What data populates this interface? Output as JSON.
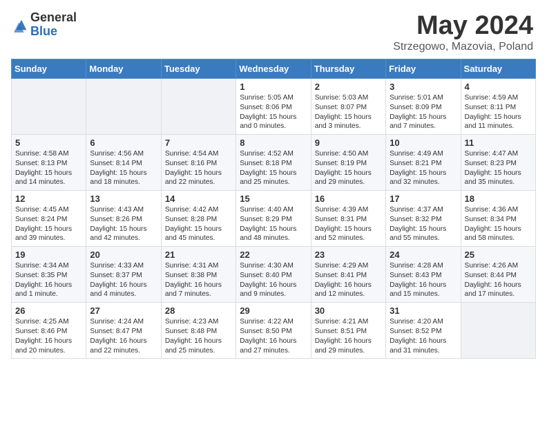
{
  "header": {
    "logo_general": "General",
    "logo_blue": "Blue",
    "month_title": "May 2024",
    "location": "Strzegowo, Mazovia, Poland"
  },
  "weekdays": [
    "Sunday",
    "Monday",
    "Tuesday",
    "Wednesday",
    "Thursday",
    "Friday",
    "Saturday"
  ],
  "weeks": [
    [
      {
        "day": "",
        "sunrise": "",
        "sunset": "",
        "daylight": ""
      },
      {
        "day": "",
        "sunrise": "",
        "sunset": "",
        "daylight": ""
      },
      {
        "day": "",
        "sunrise": "",
        "sunset": "",
        "daylight": ""
      },
      {
        "day": "1",
        "sunrise": "Sunrise: 5:05 AM",
        "sunset": "Sunset: 8:06 PM",
        "daylight": "Daylight: 15 hours and 0 minutes."
      },
      {
        "day": "2",
        "sunrise": "Sunrise: 5:03 AM",
        "sunset": "Sunset: 8:07 PM",
        "daylight": "Daylight: 15 hours and 3 minutes."
      },
      {
        "day": "3",
        "sunrise": "Sunrise: 5:01 AM",
        "sunset": "Sunset: 8:09 PM",
        "daylight": "Daylight: 15 hours and 7 minutes."
      },
      {
        "day": "4",
        "sunrise": "Sunrise: 4:59 AM",
        "sunset": "Sunset: 8:11 PM",
        "daylight": "Daylight: 15 hours and 11 minutes."
      }
    ],
    [
      {
        "day": "5",
        "sunrise": "Sunrise: 4:58 AM",
        "sunset": "Sunset: 8:13 PM",
        "daylight": "Daylight: 15 hours and 14 minutes."
      },
      {
        "day": "6",
        "sunrise": "Sunrise: 4:56 AM",
        "sunset": "Sunset: 8:14 PM",
        "daylight": "Daylight: 15 hours and 18 minutes."
      },
      {
        "day": "7",
        "sunrise": "Sunrise: 4:54 AM",
        "sunset": "Sunset: 8:16 PM",
        "daylight": "Daylight: 15 hours and 22 minutes."
      },
      {
        "day": "8",
        "sunrise": "Sunrise: 4:52 AM",
        "sunset": "Sunset: 8:18 PM",
        "daylight": "Daylight: 15 hours and 25 minutes."
      },
      {
        "day": "9",
        "sunrise": "Sunrise: 4:50 AM",
        "sunset": "Sunset: 8:19 PM",
        "daylight": "Daylight: 15 hours and 29 minutes."
      },
      {
        "day": "10",
        "sunrise": "Sunrise: 4:49 AM",
        "sunset": "Sunset: 8:21 PM",
        "daylight": "Daylight: 15 hours and 32 minutes."
      },
      {
        "day": "11",
        "sunrise": "Sunrise: 4:47 AM",
        "sunset": "Sunset: 8:23 PM",
        "daylight": "Daylight: 15 hours and 35 minutes."
      }
    ],
    [
      {
        "day": "12",
        "sunrise": "Sunrise: 4:45 AM",
        "sunset": "Sunset: 8:24 PM",
        "daylight": "Daylight: 15 hours and 39 minutes."
      },
      {
        "day": "13",
        "sunrise": "Sunrise: 4:43 AM",
        "sunset": "Sunset: 8:26 PM",
        "daylight": "Daylight: 15 hours and 42 minutes."
      },
      {
        "day": "14",
        "sunrise": "Sunrise: 4:42 AM",
        "sunset": "Sunset: 8:28 PM",
        "daylight": "Daylight: 15 hours and 45 minutes."
      },
      {
        "day": "15",
        "sunrise": "Sunrise: 4:40 AM",
        "sunset": "Sunset: 8:29 PM",
        "daylight": "Daylight: 15 hours and 48 minutes."
      },
      {
        "day": "16",
        "sunrise": "Sunrise: 4:39 AM",
        "sunset": "Sunset: 8:31 PM",
        "daylight": "Daylight: 15 hours and 52 minutes."
      },
      {
        "day": "17",
        "sunrise": "Sunrise: 4:37 AM",
        "sunset": "Sunset: 8:32 PM",
        "daylight": "Daylight: 15 hours and 55 minutes."
      },
      {
        "day": "18",
        "sunrise": "Sunrise: 4:36 AM",
        "sunset": "Sunset: 8:34 PM",
        "daylight": "Daylight: 15 hours and 58 minutes."
      }
    ],
    [
      {
        "day": "19",
        "sunrise": "Sunrise: 4:34 AM",
        "sunset": "Sunset: 8:35 PM",
        "daylight": "Daylight: 16 hours and 1 minute."
      },
      {
        "day": "20",
        "sunrise": "Sunrise: 4:33 AM",
        "sunset": "Sunset: 8:37 PM",
        "daylight": "Daylight: 16 hours and 4 minutes."
      },
      {
        "day": "21",
        "sunrise": "Sunrise: 4:31 AM",
        "sunset": "Sunset: 8:38 PM",
        "daylight": "Daylight: 16 hours and 7 minutes."
      },
      {
        "day": "22",
        "sunrise": "Sunrise: 4:30 AM",
        "sunset": "Sunset: 8:40 PM",
        "daylight": "Daylight: 16 hours and 9 minutes."
      },
      {
        "day": "23",
        "sunrise": "Sunrise: 4:29 AM",
        "sunset": "Sunset: 8:41 PM",
        "daylight": "Daylight: 16 hours and 12 minutes."
      },
      {
        "day": "24",
        "sunrise": "Sunrise: 4:28 AM",
        "sunset": "Sunset: 8:43 PM",
        "daylight": "Daylight: 16 hours and 15 minutes."
      },
      {
        "day": "25",
        "sunrise": "Sunrise: 4:26 AM",
        "sunset": "Sunset: 8:44 PM",
        "daylight": "Daylight: 16 hours and 17 minutes."
      }
    ],
    [
      {
        "day": "26",
        "sunrise": "Sunrise: 4:25 AM",
        "sunset": "Sunset: 8:46 PM",
        "daylight": "Daylight: 16 hours and 20 minutes."
      },
      {
        "day": "27",
        "sunrise": "Sunrise: 4:24 AM",
        "sunset": "Sunset: 8:47 PM",
        "daylight": "Daylight: 16 hours and 22 minutes."
      },
      {
        "day": "28",
        "sunrise": "Sunrise: 4:23 AM",
        "sunset": "Sunset: 8:48 PM",
        "daylight": "Daylight: 16 hours and 25 minutes."
      },
      {
        "day": "29",
        "sunrise": "Sunrise: 4:22 AM",
        "sunset": "Sunset: 8:50 PM",
        "daylight": "Daylight: 16 hours and 27 minutes."
      },
      {
        "day": "30",
        "sunrise": "Sunrise: 4:21 AM",
        "sunset": "Sunset: 8:51 PM",
        "daylight": "Daylight: 16 hours and 29 minutes."
      },
      {
        "day": "31",
        "sunrise": "Sunrise: 4:20 AM",
        "sunset": "Sunset: 8:52 PM",
        "daylight": "Daylight: 16 hours and 31 minutes."
      },
      {
        "day": "",
        "sunrise": "",
        "sunset": "",
        "daylight": ""
      }
    ]
  ]
}
